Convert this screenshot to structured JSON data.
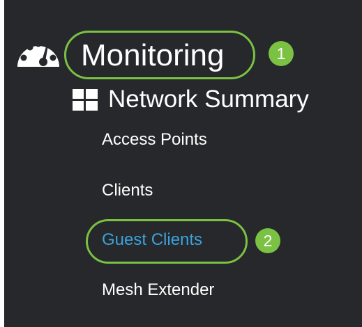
{
  "sidebar": {
    "monitoring": {
      "label": "Monitoring",
      "icon": "dashboard-gauge-icon",
      "step": "1"
    },
    "network_summary": {
      "label": "Network Summary",
      "icon": "grid-icon"
    },
    "items": [
      {
        "label": "Access Points"
      },
      {
        "label": "Clients"
      },
      {
        "label": "Guest Clients",
        "step": "2"
      },
      {
        "label": "Mesh Extender"
      }
    ]
  },
  "colors": {
    "panel_background": "#26282b",
    "highlight": "#7bc143",
    "selected_text": "#3ba3dc",
    "text": "#ffffff"
  }
}
